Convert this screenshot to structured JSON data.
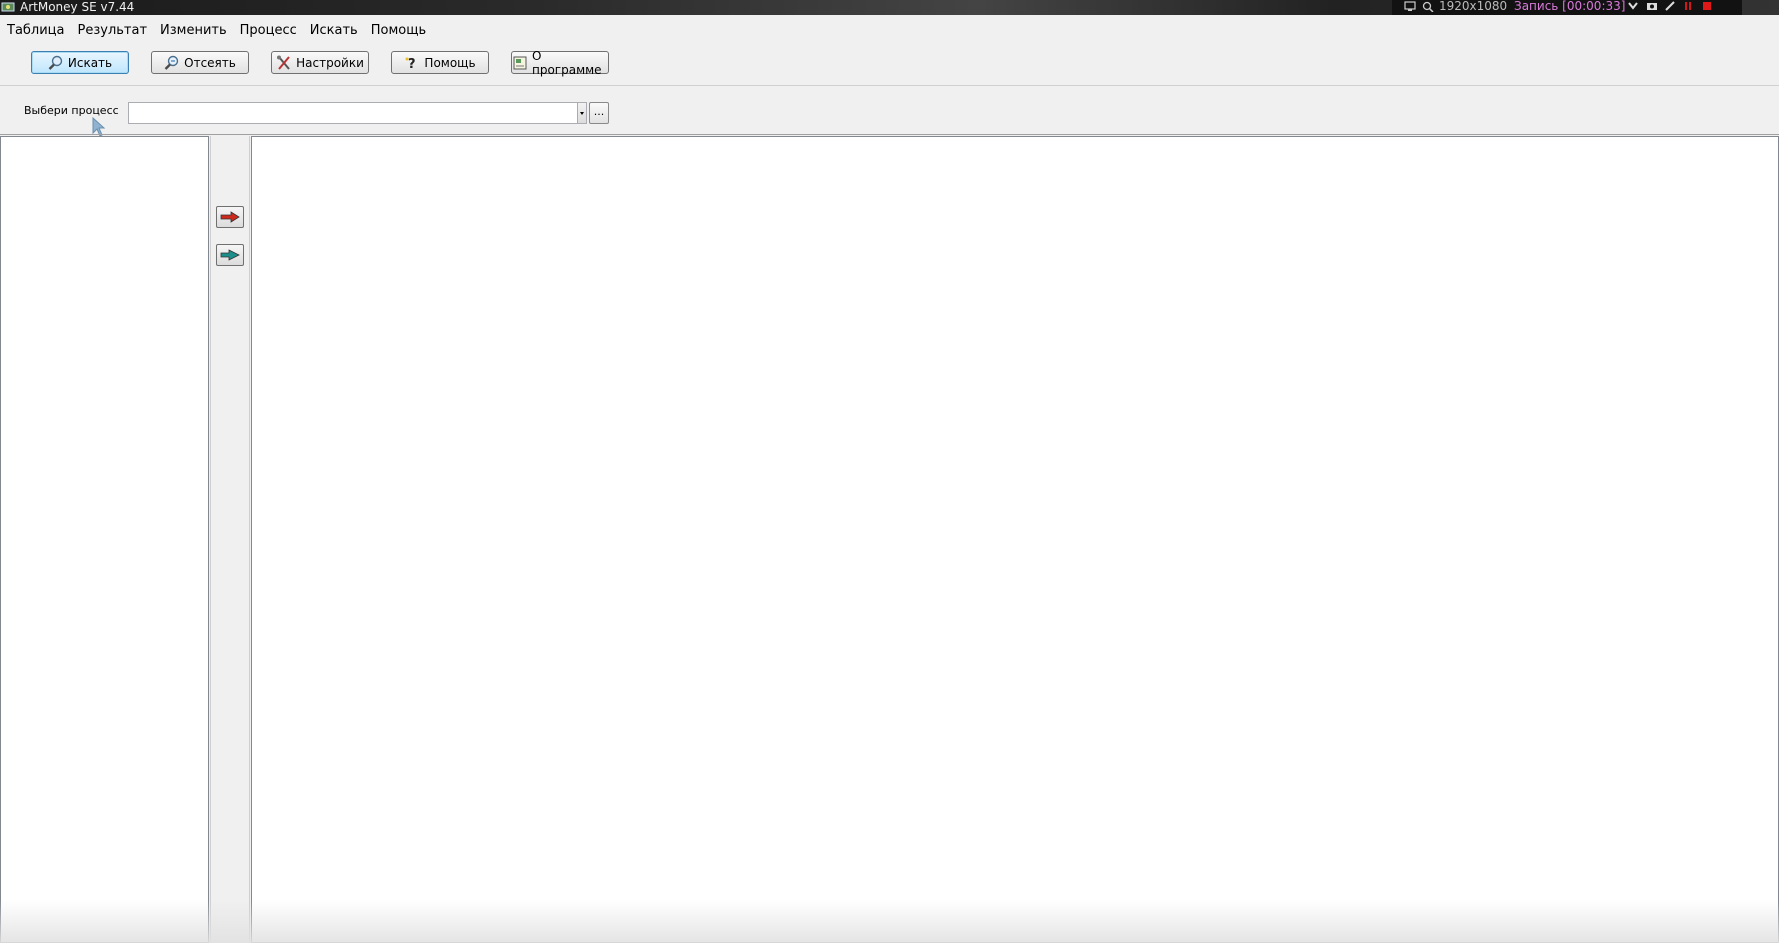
{
  "window": {
    "title": "ArtMoney SE v7.44"
  },
  "recorder": {
    "resolution": "1920x1080",
    "status": "Запись [00:00:33]"
  },
  "menu": {
    "items": [
      "Таблица",
      "Результат",
      "Изменить",
      "Процесс",
      "Искать",
      "Помощь"
    ]
  },
  "toolbar": {
    "search_label": "Искать",
    "filter_label": "Отсеять",
    "settings_label": "Настройки",
    "help_label": "Помощь",
    "about_label": "О программе"
  },
  "process": {
    "label": "Выбери процесс",
    "value": "",
    "more_label": "..."
  },
  "colors": {
    "accent_focus": "#3c7fb1",
    "arrow_red": "#cc2a1c",
    "arrow_teal": "#1c8f8c",
    "record_time": "#d77ad8"
  }
}
